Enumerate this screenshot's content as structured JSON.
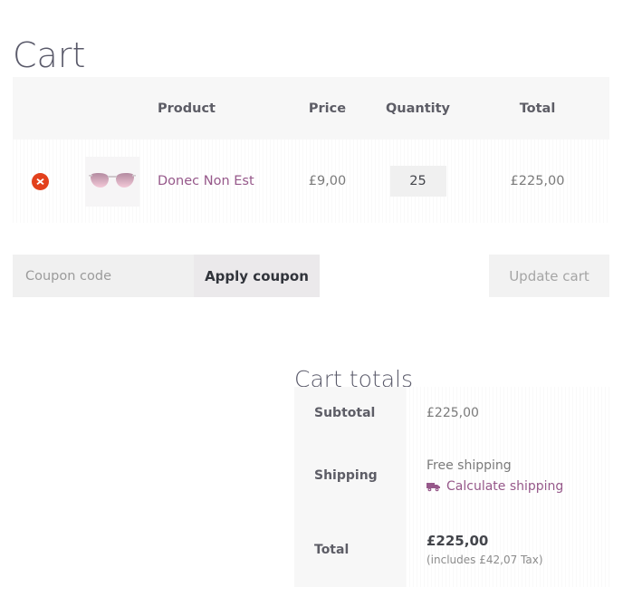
{
  "page": {
    "title": "Cart"
  },
  "cart_table": {
    "headers": {
      "remove": "",
      "thumbnail": "",
      "product": "Product",
      "price": "Price",
      "quantity": "Quantity",
      "total": "Total"
    },
    "rows": [
      {
        "remove_icon": "remove-circle-x-icon",
        "thumbnail_icon": "sunglasses-product-thumbnail",
        "product_name": "Donec Non Est",
        "price": "£9,00",
        "quantity": "25",
        "total": "£225,00"
      }
    ]
  },
  "actions": {
    "coupon_placeholder": "Coupon code",
    "coupon_value": "",
    "apply_coupon_label": "Apply coupon",
    "update_cart_label": "Update cart"
  },
  "cart_totals": {
    "heading": "Cart totals",
    "rows": [
      {
        "label": "Subtotal",
        "value": "£225,00"
      },
      {
        "label": "Shipping",
        "value": "Free shipping",
        "link_label": "Calculate shipping",
        "link_icon": "delivery-truck-icon"
      },
      {
        "label": "Total",
        "value": "£225,00",
        "note": "(includes £42,07 Tax)"
      }
    ]
  },
  "colors": {
    "accent_link": "#96588a",
    "remove_badge": "#e2401c",
    "header_band": "#f7f7f7",
    "button_grey": "#ebe9eb",
    "text_dark": "#43454b",
    "text_muted": "#7a7a7a"
  }
}
